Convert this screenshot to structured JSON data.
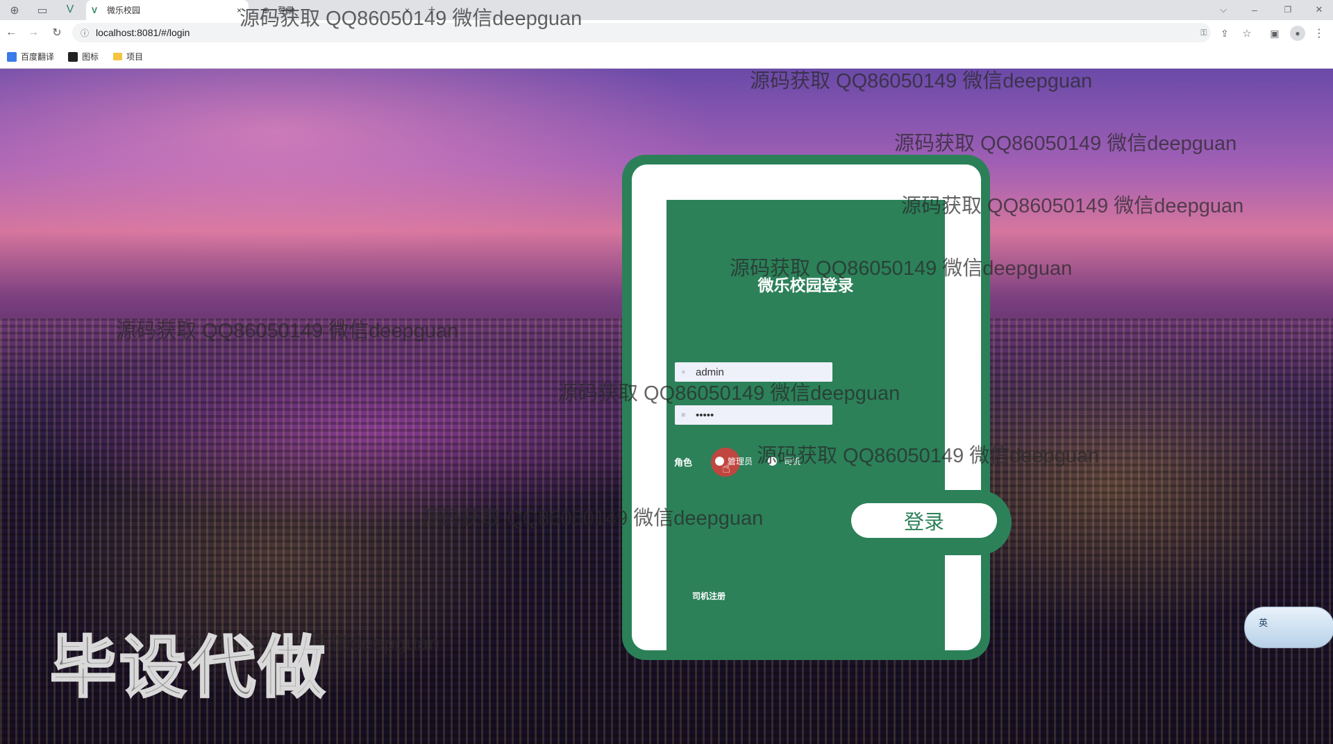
{
  "browser": {
    "tabs": [
      {
        "title": "微乐校园",
        "close": "×"
      },
      {
        "title": "登录",
        "close": "×"
      }
    ],
    "new_tab": "+",
    "window_controls": {
      "chevron": "⌵",
      "minimize": "–",
      "restore": "❐",
      "close": "✕"
    },
    "url": "localhost:8081/#/login",
    "bookmarks": [
      "百度翻译",
      "图标",
      "项目"
    ],
    "icons": [
      "back-icon",
      "forward-icon",
      "reload-icon",
      "info-icon",
      "key-icon",
      "share-icon",
      "star-icon",
      "sidebar-icon",
      "profile-icon",
      "menu-icon"
    ]
  },
  "watermark": "源码获取 QQ86050149 微信deepguan",
  "login": {
    "title": "微乐校园登录",
    "username_value": "admin",
    "password_value": "•••••",
    "role_label": "角色",
    "roles": [
      "管理员",
      "司机"
    ],
    "selected_role": "管理员",
    "submit_label": "登录",
    "register_link": "司机注册"
  },
  "overlay": {
    "brand_text": "毕设代做",
    "ime_label": "英"
  },
  "colors": {
    "card_green": "#2c8159",
    "white": "#ffffff"
  }
}
